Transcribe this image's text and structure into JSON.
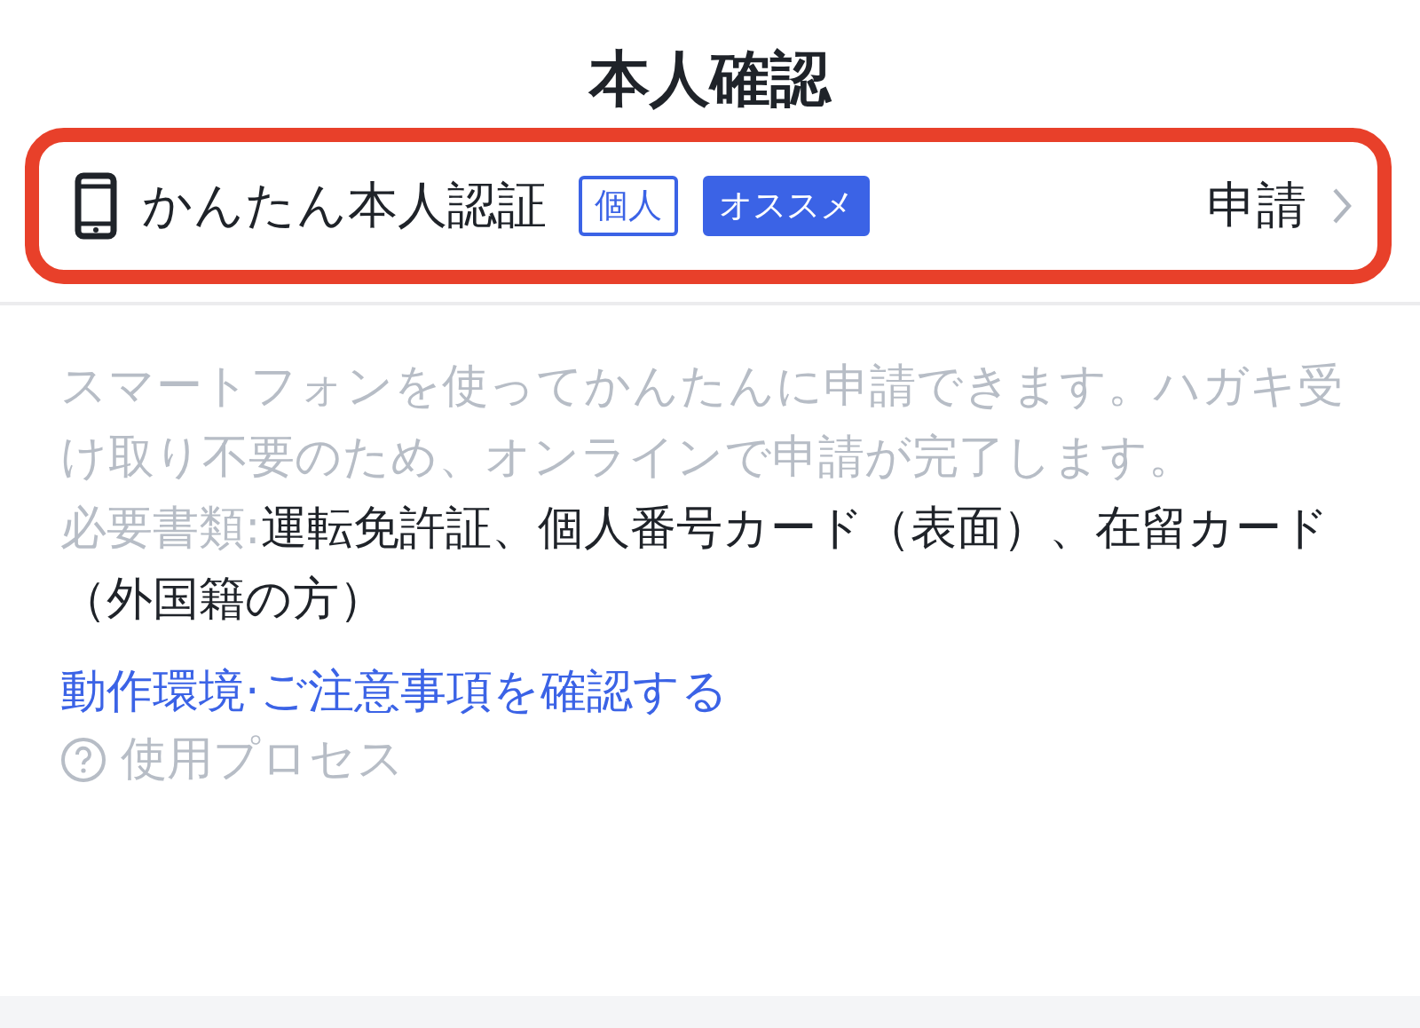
{
  "header": {
    "title": "本人確認"
  },
  "method": {
    "highlighted": true,
    "name": "かんたん本人認証",
    "tags": [
      {
        "label": "個人",
        "kind": "outline"
      },
      {
        "label": "オススメ",
        "kind": "filled"
      }
    ],
    "action": "申請"
  },
  "description": "スマートフォンを使ってかんたんに申請できます。ハガキ受け取り不要のため、オンラインで申請が完了します。",
  "documents": {
    "label": "必要書類:",
    "value": "運転免許証、個人番号カード（表面）、在留カード（外国籍の方）"
  },
  "link": "動作環境·ご注意事項を確認する",
  "help": "使用プロセス"
}
